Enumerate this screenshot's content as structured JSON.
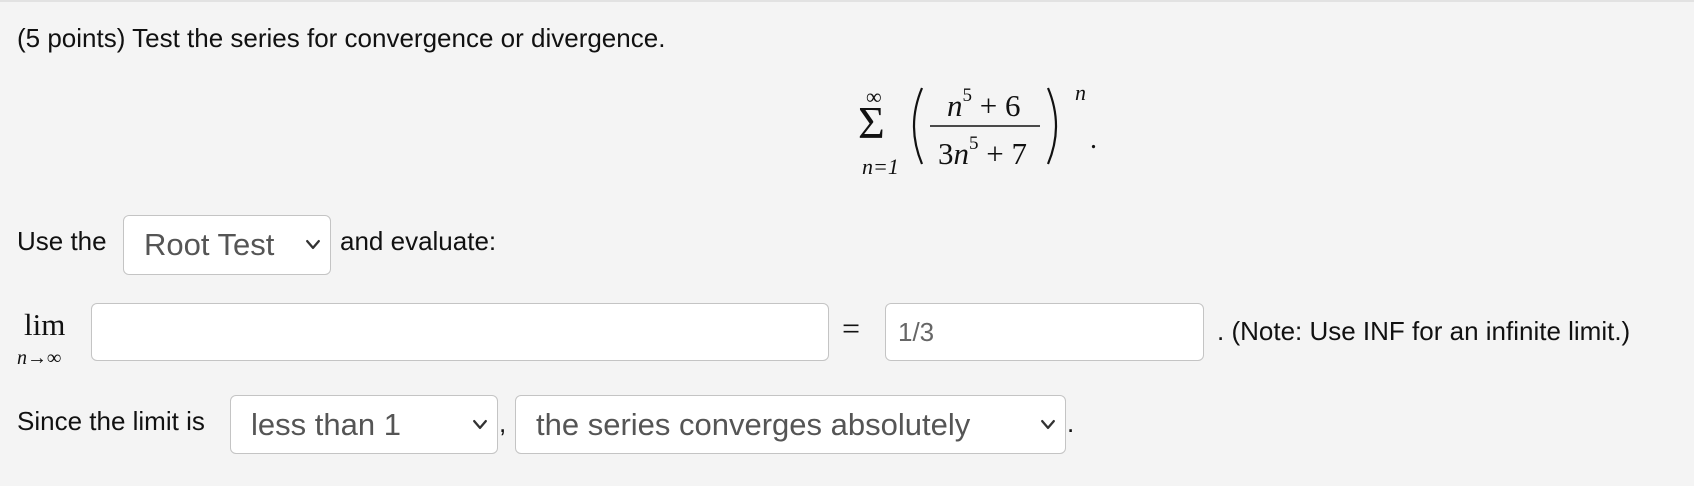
{
  "question": {
    "intro": "(5 points) Test the series for convergence or divergence."
  },
  "series": {
    "sum_lower": "n=1",
    "sum_upper": "∞",
    "sigma": "Σ",
    "num_base": "n",
    "num_exp": "5",
    "num_rest": "+ 6",
    "den_coeff": "3",
    "den_base": "n",
    "den_exp": "5",
    "den_rest": "+ 7",
    "outer_exp": "n",
    "trailing": "."
  },
  "test_row": {
    "prefix": "Use the",
    "selected_test": "Root Test",
    "suffix": "and evaluate:"
  },
  "limit_row": {
    "lim": "lim",
    "sub": "n→∞",
    "expression_value": "",
    "equals": "=",
    "result_value": "1/3",
    "note": ". (Note: Use INF for an infinite limit.)"
  },
  "conclusion_row": {
    "prefix": "Since the limit is",
    "comparison_selected": "less than 1",
    "comma": ",",
    "conclusion_selected": "the series converges absolutely",
    "period": "."
  },
  "icons": {
    "dropdown": "chevron-down-icon"
  }
}
